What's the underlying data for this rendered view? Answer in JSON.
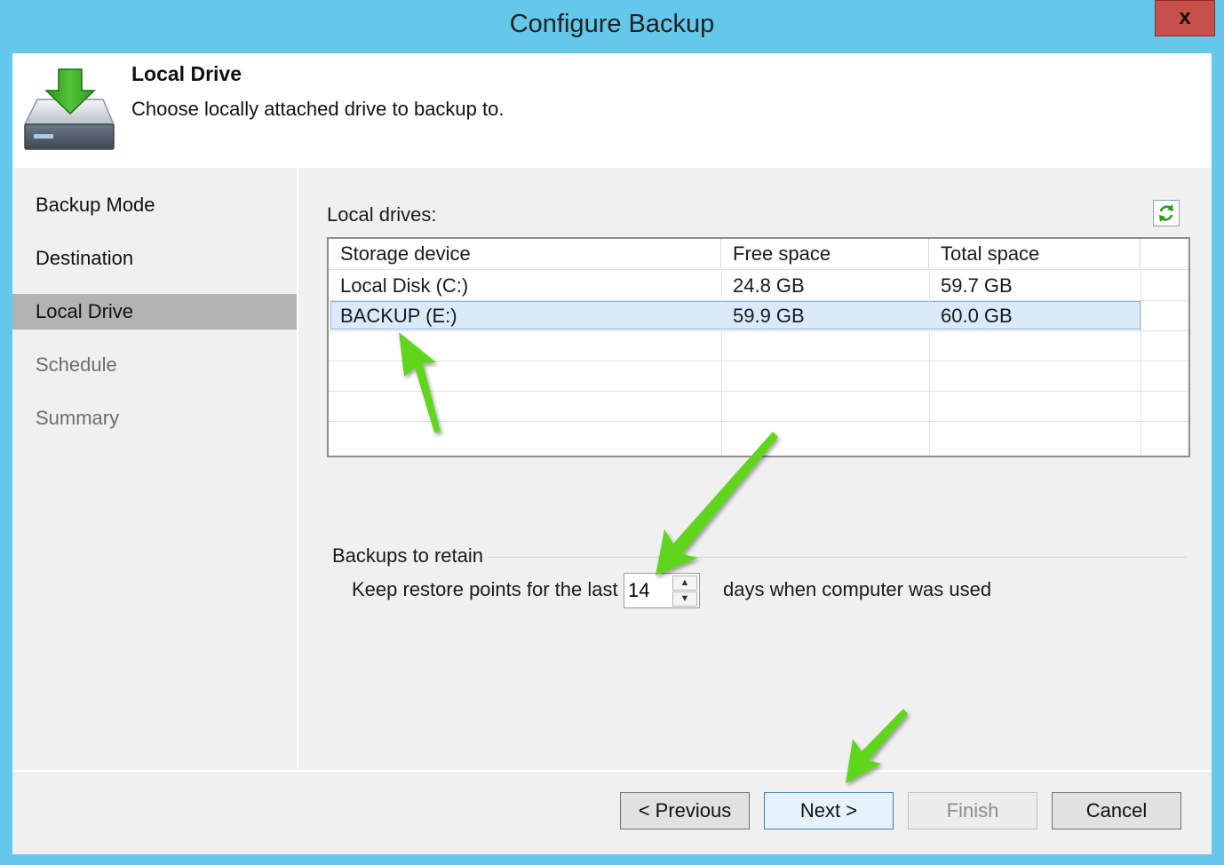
{
  "window": {
    "title": "Configure Backup",
    "close_label": "x"
  },
  "header": {
    "title": "Local Drive",
    "subtitle": "Choose locally attached drive to backup to.",
    "icon": "drive-download-icon"
  },
  "nav": {
    "items": [
      {
        "label": "Backup Mode",
        "state": "done"
      },
      {
        "label": "Destination",
        "state": "done"
      },
      {
        "label": "Local Drive",
        "state": "active"
      },
      {
        "label": "Schedule",
        "state": "disabled"
      },
      {
        "label": "Summary",
        "state": "disabled"
      }
    ]
  },
  "drives": {
    "label": "Local drives:",
    "refresh_icon": "refresh-icon",
    "columns": [
      "Storage device",
      "Free space",
      "Total space"
    ],
    "rows": [
      {
        "device": "Local Disk (C:)",
        "free": "24.8 GB",
        "total": "59.7 GB",
        "selected": false
      },
      {
        "device": "BACKUP (E:)",
        "free": "59.9 GB",
        "total": "60.0 GB",
        "selected": true
      }
    ]
  },
  "retention": {
    "group_label": "Backups to retain",
    "prefix": "Keep restore points for the last",
    "days": "14",
    "suffix": "days when computer was used"
  },
  "buttons": {
    "previous": "< Previous",
    "next": "Next >",
    "finish": "Finish",
    "cancel": "Cancel"
  },
  "colors": {
    "titlebar": "#63c8ea",
    "close": "#c7504a",
    "nav_active": "#b3b3b3",
    "selection": "#dbeafb",
    "annotation_arrow": "#5fd61d"
  }
}
